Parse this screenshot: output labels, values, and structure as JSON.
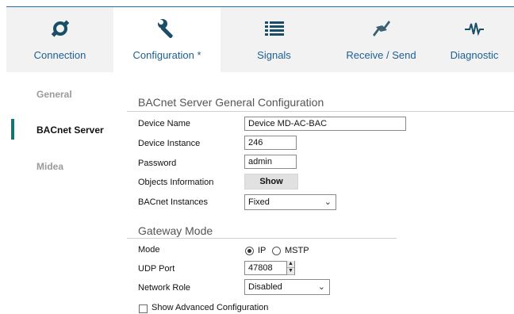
{
  "tabs": [
    {
      "label": "Connection",
      "icon": "plug-icon"
    },
    {
      "label": "Configuration *",
      "icon": "wrench-icon",
      "active": true
    },
    {
      "label": "Signals",
      "icon": "list-icon"
    },
    {
      "label": "Receive / Send",
      "icon": "arrows-exchange-icon"
    },
    {
      "label": "Diagnostic",
      "icon": "pulse-icon"
    }
  ],
  "sidebar": {
    "items": [
      {
        "label": "General"
      },
      {
        "label": "BACnet Server",
        "active": true
      },
      {
        "label": "Midea"
      }
    ]
  },
  "config": {
    "title": "BACnet Server General Configuration",
    "device_name_label": "Device Name",
    "device_name_value": "Device MD-AC-BAC",
    "device_instance_label": "Device Instance",
    "device_instance_value": "246",
    "password_label": "Password",
    "password_value": "admin",
    "objects_info_label": "Objects Information",
    "objects_info_button": "Show",
    "instances_label": "BACnet Instances",
    "instances_value": "Fixed"
  },
  "gateway": {
    "title": "Gateway Mode",
    "mode_label": "Mode",
    "mode_options": [
      "IP",
      "MSTP"
    ],
    "mode_selected": "IP",
    "udp_label": "UDP Port",
    "udp_value": "47808",
    "role_label": "Network Role",
    "role_value": "Disabled"
  },
  "advanced": {
    "label": "Show Advanced Configuration",
    "checked": false
  },
  "colors": {
    "accent": "#1d5f93",
    "active_marker": "#1a7370",
    "tabbar_bg": "#f2f2f2"
  }
}
